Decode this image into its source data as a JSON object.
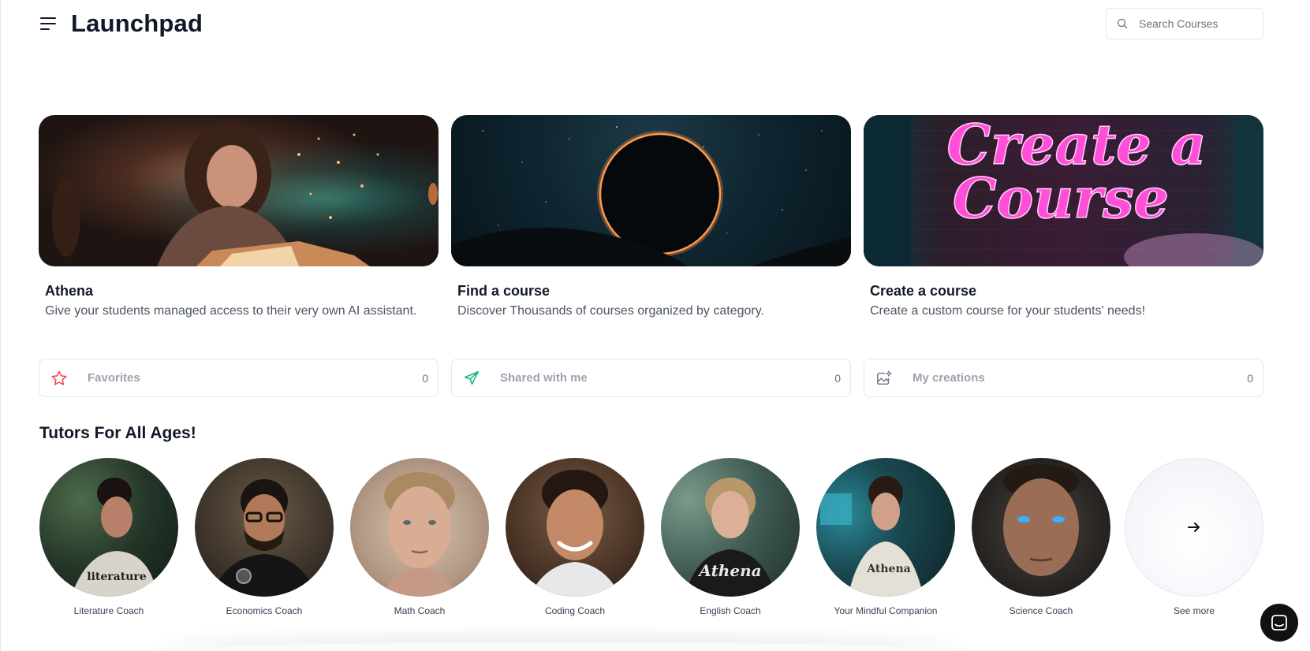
{
  "header": {
    "title": "Launchpad",
    "search_placeholder": "Search Courses"
  },
  "features": [
    {
      "title": "Athena",
      "description": "Give your students managed access to their very own AI assistant."
    },
    {
      "title": "Find a course",
      "description": "Discover Thousands of courses organized by category."
    },
    {
      "title": "Create a course",
      "description": "Create a custom course for your students' needs!",
      "banner_text_line1": "Create a",
      "banner_text_line2": "Course"
    }
  ],
  "tiles": [
    {
      "label": "Favorites",
      "count": "0",
      "icon": "star-icon",
      "icon_color": "#ef4444"
    },
    {
      "label": "Shared with me",
      "count": "0",
      "icon": "send-icon",
      "icon_color": "#10b981"
    },
    {
      "label": "My creations",
      "count": "0",
      "icon": "sparkle-image-icon",
      "icon_color": "#6b7280"
    }
  ],
  "tutors_section": {
    "title": "Tutors For All Ages!",
    "tutors": [
      {
        "name": "Literature Coach",
        "shirt_text": "literature"
      },
      {
        "name": "Economics Coach"
      },
      {
        "name": "Math Coach"
      },
      {
        "name": "Coding Coach"
      },
      {
        "name": "English Coach",
        "shirt_text": "Athena"
      },
      {
        "name": "Your Mindful Companion",
        "shirt_text": "Athena"
      },
      {
        "name": "Science Coach"
      }
    ],
    "see_more_label": "See more"
  },
  "colors": {
    "neon_pink": "#ff4fd8",
    "eclipse_ring": "#ff8a3d"
  }
}
